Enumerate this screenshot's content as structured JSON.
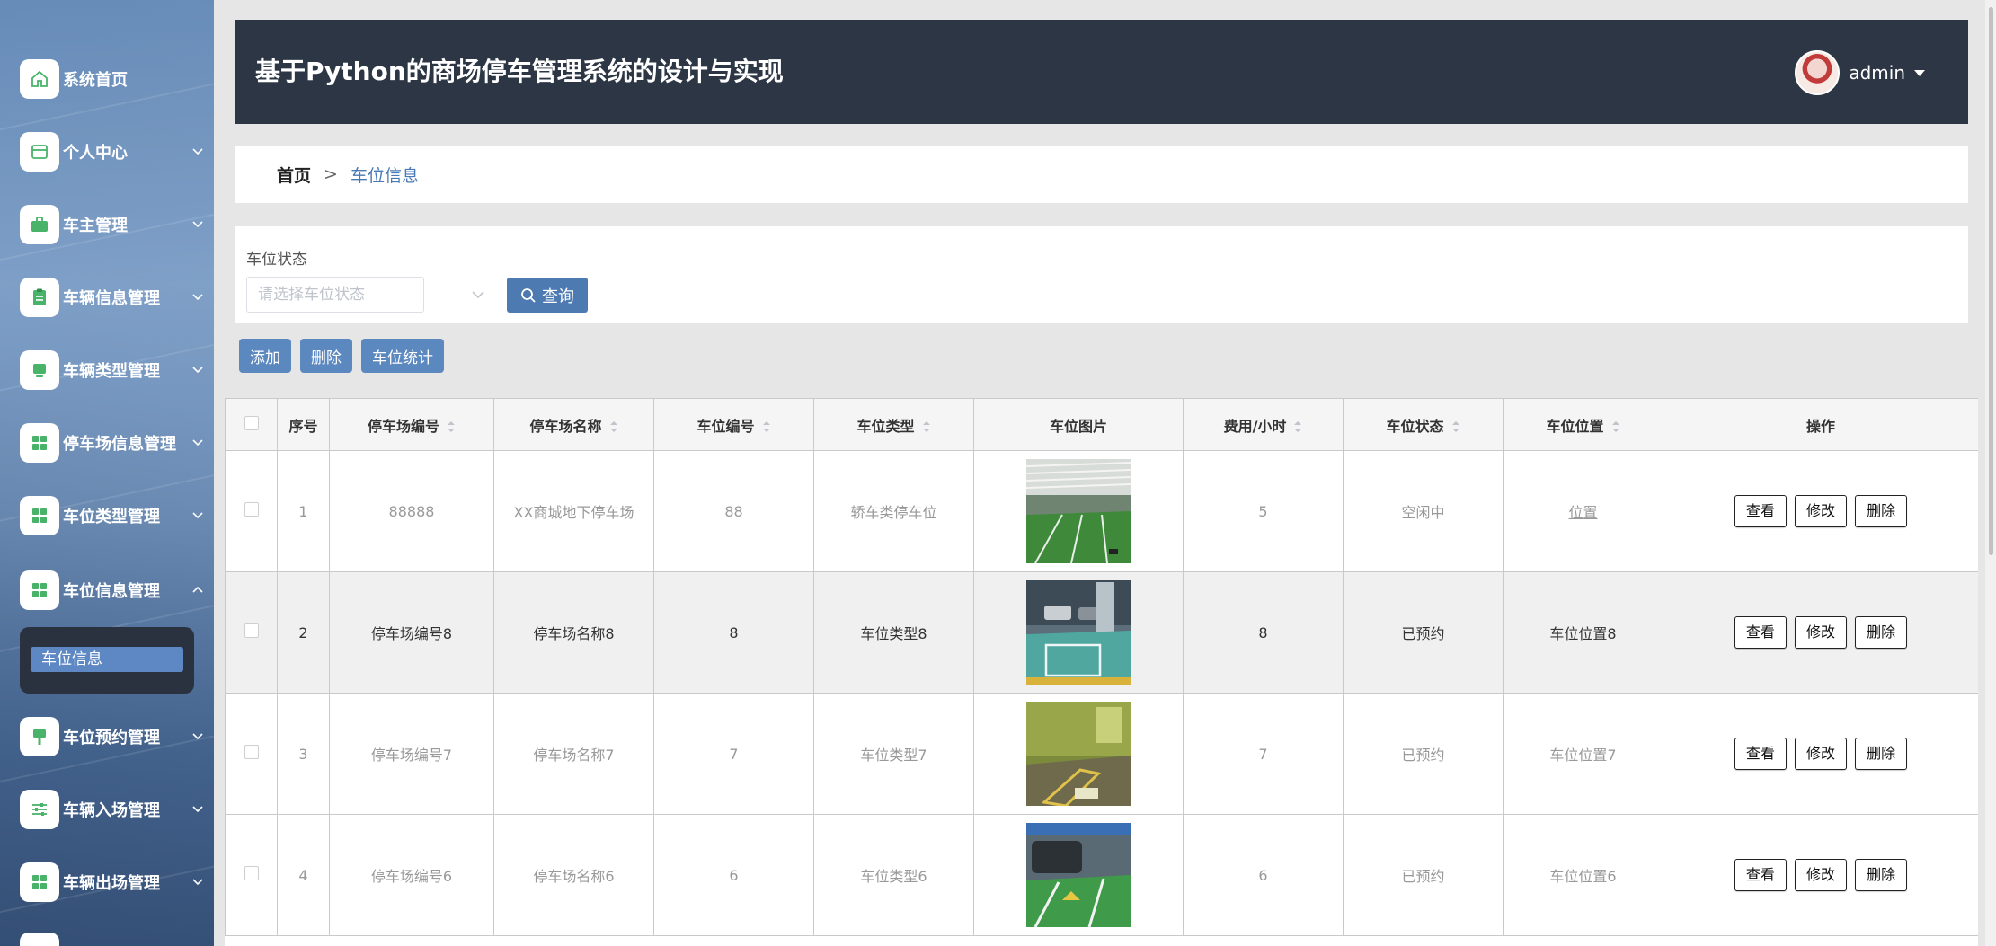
{
  "app": {
    "title": "基于Python的商场停车管理系统的设计与实现",
    "username": "admin"
  },
  "sidebar": {
    "items": [
      {
        "label": "系统首页",
        "icon": "home-icon"
      },
      {
        "label": "个人中心",
        "icon": "card-icon"
      },
      {
        "label": "车主管理",
        "icon": "briefcase-icon"
      },
      {
        "label": "车辆信息管理",
        "icon": "clipboard-icon"
      },
      {
        "label": "车辆类型管理",
        "icon": "monitor-icon"
      },
      {
        "label": "停车场信息管理",
        "icon": "grid-icon"
      },
      {
        "label": "车位类型管理",
        "icon": "grid-icon"
      },
      {
        "label": "车位信息管理",
        "icon": "grid-icon"
      },
      {
        "label": "车位预约管理",
        "icon": "sign-icon"
      },
      {
        "label": "车辆入场管理",
        "icon": "sliders-icon"
      },
      {
        "label": "车辆出场管理",
        "icon": "grid-icon"
      }
    ],
    "submenu": {
      "label": "车位信息"
    }
  },
  "breadcrumb": {
    "home": "首页",
    "separator": ">",
    "current": "车位信息"
  },
  "search": {
    "label": "车位状态",
    "placeholder": "请选择车位状态",
    "query_label": "查询"
  },
  "actions": {
    "add": "添加",
    "delete": "删除",
    "stats": "车位统计"
  },
  "table": {
    "headers": [
      "序号",
      "停车场编号",
      "停车场名称",
      "车位编号",
      "车位类型",
      "车位图片",
      "费用/小时",
      "车位状态",
      "车位位置",
      "操作"
    ],
    "rows": [
      {
        "index": "1",
        "lot_no": "88888",
        "lot_name": "XX商城地下停车场",
        "space_no": "88",
        "space_type": "轿车类停车位",
        "fee": "5",
        "status": "空闲中",
        "location": "位置"
      },
      {
        "index": "2",
        "lot_no": "停车场编号8",
        "lot_name": "停车场名称8",
        "space_no": "8",
        "space_type": "车位类型8",
        "fee": "8",
        "status": "已预约",
        "location": "车位位置8"
      },
      {
        "index": "3",
        "lot_no": "停车场编号7",
        "lot_name": "停车场名称7",
        "space_no": "7",
        "space_type": "车位类型7",
        "fee": "7",
        "status": "已预约",
        "location": "车位位置7"
      },
      {
        "index": "4",
        "lot_no": "停车场编号6",
        "lot_name": "停车场名称6",
        "space_no": "6",
        "space_type": "车位类型6",
        "fee": "6",
        "status": "已预约",
        "location": "车位位置6"
      }
    ],
    "ops": {
      "view": "查看",
      "edit": "修改",
      "delete": "删除"
    }
  },
  "colors": {
    "header_bg": "#2d3644",
    "accent": "#5c88c0",
    "query_button": "#4e7ab2",
    "icon_green": "#49b36a"
  }
}
